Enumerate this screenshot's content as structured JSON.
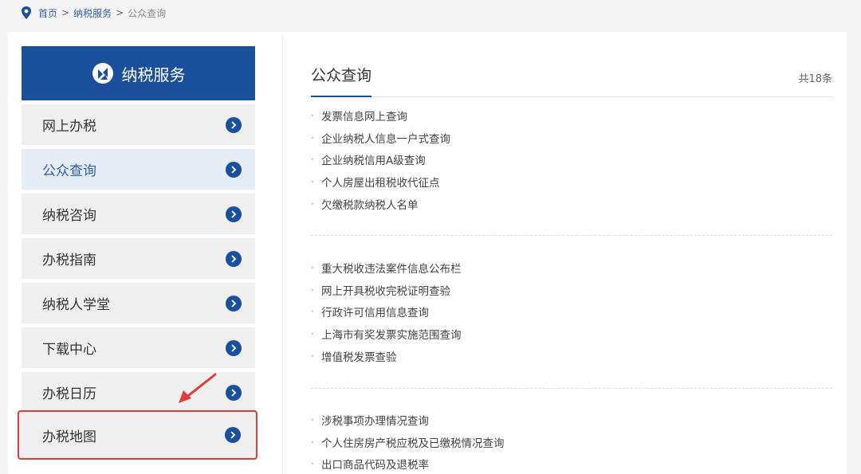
{
  "breadcrumb": {
    "home": "首页",
    "level1": "纳税服务",
    "current": "公众查询",
    "separator": ">"
  },
  "sidebar": {
    "title": "纳税服务",
    "items": [
      {
        "label": "网上办税"
      },
      {
        "label": "公众查询"
      },
      {
        "label": "纳税咨询"
      },
      {
        "label": "办税指南"
      },
      {
        "label": "纳税人学堂"
      },
      {
        "label": "下载中心"
      },
      {
        "label": "办税日历"
      },
      {
        "label": "办税地图"
      }
    ]
  },
  "content": {
    "title": "公众查询",
    "count": "共18条",
    "groups": [
      [
        "发票信息网上查询",
        "企业纳税人信息一户式查询",
        "企业纳税信用A级查询",
        "个人房屋出租税收代征点",
        "欠缴税款纳税人名单"
      ],
      [
        "重大税收违法案件信息公布栏",
        "网上开具税收完税证明查验",
        "行政许可信用信息查询",
        "上海市有奖发票实施范围查询",
        "增值税发票查验"
      ],
      [
        "涉税事项办理情况查询",
        "个人住房房产税应税及已缴税情况查询",
        "出口商品代码及退税率"
      ]
    ],
    "bullet": "·"
  },
  "colors": {
    "brand": "#1a4f9c",
    "highlight": "#e23b3b"
  }
}
